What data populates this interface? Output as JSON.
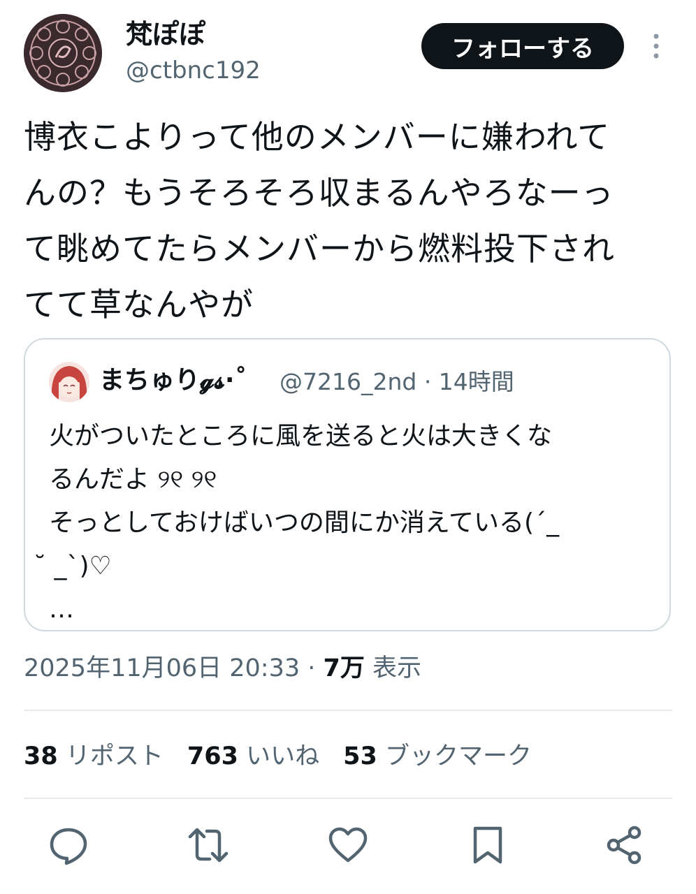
{
  "author": {
    "display_name": "梵ぽぽ",
    "handle": "@ctbnc192"
  },
  "follow_button": {
    "label": "フォローする"
  },
  "tweet": {
    "lines": [
      "博衣こよりって他のメンバーに嫌われて",
      "んの？もうそろそろ収まるんやろなーっ",
      "て眺めてたらメンバーから燃料投下され",
      "てて草なんやが"
    ]
  },
  "quoted": {
    "display_name": "まちゅり𝓰𝓼·˚",
    "meta": "@7216_2nd · 14時間",
    "lines": [
      "火がついたところに風を送ると火は大きくな",
      "るんだよ ୨୧ ୨୧",
      "そっとしておけばいつの間にか消えている(ˊ_",
      "˘ _ˋ)♡",
      "…"
    ]
  },
  "meta": {
    "timestamp": "2025年11月06日 20:33 · ",
    "views_count": "7万",
    "views_label": " 表示"
  },
  "stats": {
    "reposts_count": "38",
    "reposts_label": "リポスト",
    "likes_count": "763",
    "likes_label": "いいね",
    "bookmarks_count": "53",
    "bookmarks_label": "ブックマーク"
  },
  "icons": [
    "more-icon",
    "reply-icon",
    "retweet-icon",
    "like-icon",
    "bookmark-icon",
    "share-icon"
  ]
}
